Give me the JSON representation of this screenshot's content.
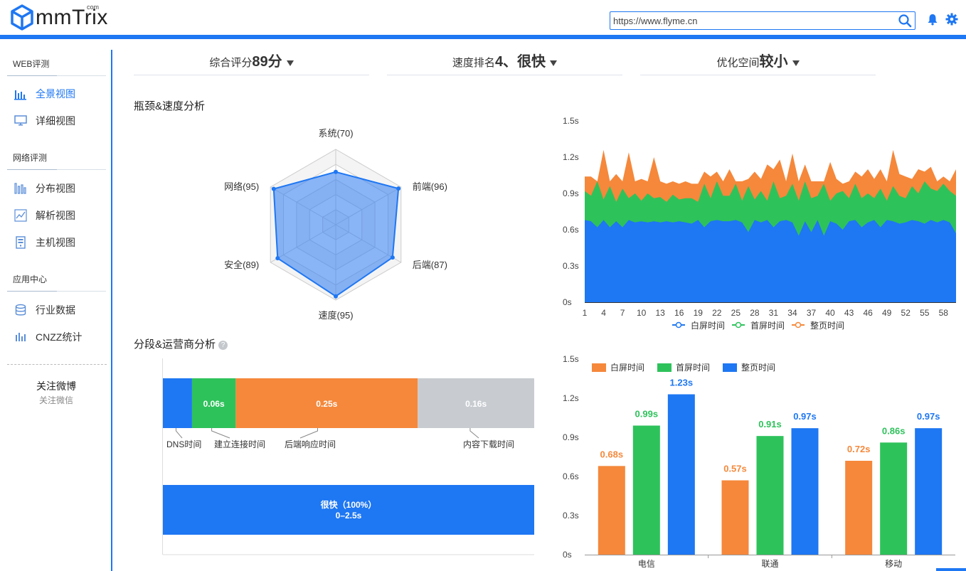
{
  "header": {
    "logo_text": "mmTrix",
    "logo_sup": "com",
    "url_value": "https://www.flyme.cn"
  },
  "sidebar": {
    "sections": [
      {
        "title": "WEB评测",
        "items": [
          {
            "label": "全景视图",
            "icon": "bar-chart-icon",
            "active": true
          },
          {
            "label": "详细视图",
            "icon": "monitor-icon"
          }
        ]
      },
      {
        "title": "网络评测",
        "items": [
          {
            "label": "分布视图",
            "icon": "distribution-icon"
          },
          {
            "label": "解析视图",
            "icon": "line-chart-icon"
          },
          {
            "label": "主机视图",
            "icon": "server-icon"
          }
        ]
      },
      {
        "title": "应用中心",
        "items": [
          {
            "label": "行业数据",
            "icon": "database-icon"
          },
          {
            "label": "CNZZ统计",
            "icon": "stats-icon"
          }
        ]
      }
    ],
    "follow_weibo": "关注微博",
    "follow_weixin": "关注微信"
  },
  "summary": {
    "score_label": "综合评分",
    "score_value": "89分",
    "rank_label": "速度排名",
    "rank_value": "4、很快",
    "space_label": "优化空间",
    "space_value": "较小"
  },
  "sections": {
    "radar_title": "瓶颈&速度分析",
    "segment_title": "分段&运营商分析",
    "help": "?"
  },
  "chart_data": [
    {
      "type": "radar",
      "axes": [
        "系统(70)",
        "前端(96)",
        "后端(87)",
        "速度(95)",
        "安全(89)",
        "网络(95)"
      ],
      "values": [
        70,
        96,
        87,
        95,
        89,
        95
      ],
      "max": 100,
      "color": "#3b82f0"
    },
    {
      "type": "area",
      "stacked": true,
      "x": [
        1,
        2,
        3,
        4,
        5,
        6,
        7,
        8,
        9,
        10,
        11,
        12,
        13,
        14,
        15,
        16,
        17,
        18,
        19,
        20,
        21,
        22,
        23,
        24,
        25,
        26,
        27,
        28,
        29,
        30,
        31,
        32,
        33,
        34,
        35,
        36,
        37,
        38,
        39,
        40,
        41,
        42,
        43,
        44,
        45,
        46,
        47,
        48,
        49,
        50,
        51,
        52,
        53,
        54,
        55,
        56,
        57,
        58,
        59,
        60
      ],
      "x_ticks": [
        1,
        4,
        7,
        10,
        13,
        16,
        19,
        22,
        25,
        28,
        31,
        34,
        37,
        40,
        43,
        46,
        49,
        52,
        55,
        58
      ],
      "y_ticks": [
        "0s",
        "0.3s",
        "0.6s",
        "0.9s",
        "1.2s",
        "1.5s"
      ],
      "ylim": [
        0,
        1.5
      ],
      "series": [
        {
          "name": "白屏时间",
          "color": "#1e77f3",
          "values": [
            0.68,
            0.67,
            0.62,
            0.68,
            0.62,
            0.67,
            0.62,
            0.68,
            0.66,
            0.67,
            0.66,
            0.67,
            0.66,
            0.67,
            0.66,
            0.67,
            0.66,
            0.65,
            0.68,
            0.62,
            0.67,
            0.68,
            0.67,
            0.67,
            0.68,
            0.66,
            0.58,
            0.68,
            0.66,
            0.68,
            0.62,
            0.67,
            0.68,
            0.66,
            0.55,
            0.67,
            0.58,
            0.68,
            0.55,
            0.67,
            0.65,
            0.6,
            0.67,
            0.68,
            0.62,
            0.66,
            0.68,
            0.62,
            0.68,
            0.67,
            0.65,
            0.66,
            0.68,
            0.67,
            0.65,
            0.68,
            0.66,
            0.68,
            0.66,
            0.57
          ]
        },
        {
          "name": "首屏时间",
          "color": "#2ec25b",
          "values": [
            0.92,
            0.88,
            1.0,
            0.85,
            0.96,
            0.83,
            0.94,
            0.86,
            0.9,
            0.84,
            0.9,
            0.86,
            0.87,
            0.83,
            0.89,
            0.85,
            0.86,
            0.86,
            0.83,
            0.98,
            0.86,
            1.0,
            0.88,
            0.88,
            0.98,
            0.84,
            0.96,
            0.85,
            0.92,
            0.84,
            1.0,
            0.86,
            0.88,
            0.98,
            0.84,
            1.0,
            0.86,
            0.88,
            0.98,
            0.84,
            0.9,
            0.92,
            0.86,
            0.98,
            0.86,
            0.9,
            0.86,
            0.94,
            0.84,
            0.96,
            0.88,
            0.86,
            0.96,
            0.9,
            1.0,
            0.94,
            0.92,
            0.98,
            0.92,
            0.88
          ]
        },
        {
          "name": "整页时间",
          "color": "#f5883b",
          "values": [
            1.04,
            1.04,
            1.0,
            1.26,
            1.0,
            1.06,
            1.0,
            1.24,
            1.0,
            1.02,
            1.0,
            1.2,
            1.0,
            0.98,
            1.0,
            0.98,
            1.0,
            0.98,
            0.98,
            1.08,
            1.04,
            1.08,
            1.0,
            1.1,
            1.0,
            1.0,
            1.02,
            1.08,
            1.02,
            1.14,
            1.1,
            1.18,
            1.0,
            1.23,
            1.0,
            1.14,
            1.0,
            1.0,
            1.0,
            1.16,
            1.02,
            0.98,
            1.0,
            1.08,
            1.04,
            1.1,
            1.02,
            1.1,
            1.0,
            1.26,
            1.06,
            1.04,
            1.02,
            1.1,
            1.08,
            1.12,
            1.0,
            1.04,
            1.0,
            1.1
          ]
        }
      ]
    },
    {
      "type": "bar",
      "orientation": "horizontal-stacked",
      "segments": [
        {
          "label": "DNS时间",
          "value": 0.04,
          "color": "#1e77f3",
          "text": ""
        },
        {
          "label": "建立连接时间",
          "value": 0.06,
          "color": "#2ec25b",
          "text": "0.06s"
        },
        {
          "label": "后端响应时间",
          "value": 0.25,
          "color": "#f5883b",
          "text": "0.25s"
        },
        {
          "label": "内容下载时间",
          "value": 0.16,
          "color": "#c8ccd1",
          "text": "0.16s"
        }
      ],
      "speed_bar": {
        "line1": "很快（100%）",
        "line2": "0–2.5s",
        "color": "#1e77f3"
      }
    },
    {
      "type": "bar",
      "categories": [
        "电信",
        "联通",
        "移动"
      ],
      "y_ticks": [
        "0s",
        "0.3s",
        "0.6s",
        "0.9s",
        "1.2s",
        "1.5s"
      ],
      "ylim": [
        0,
        1.5
      ],
      "series": [
        {
          "name": "白屏时间",
          "color": "#f5883b",
          "values": [
            0.68,
            0.57,
            0.72
          ],
          "labels": [
            "0.68s",
            "0.57s",
            "0.72s"
          ]
        },
        {
          "name": "首屏时间",
          "color": "#2ec25b",
          "values": [
            0.99,
            0.91,
            0.86
          ],
          "labels": [
            "0.99s",
            "0.91s",
            "0.86s"
          ]
        },
        {
          "name": "整页时间",
          "color": "#1e77f3",
          "values": [
            1.23,
            0.97,
            0.97
          ],
          "labels": [
            "1.23s",
            "0.97s",
            "0.97s"
          ]
        }
      ]
    }
  ]
}
